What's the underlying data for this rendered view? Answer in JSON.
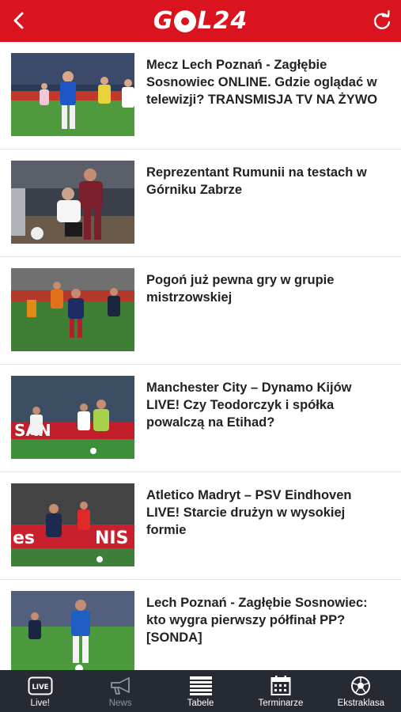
{
  "header": {
    "logo_text_left": "G",
    "logo_text_right": "L24",
    "back_icon": "chevron-left-icon",
    "refresh_icon": "refresh-icon",
    "bar_color": "#d9141f"
  },
  "articles": [
    {
      "title": "Mecz Lech Poznań - Zagłębie Sosnowiec ONLINE. Gdzie oglądać w telewizji? TRANSMISJA TV NA ŻYWO"
    },
    {
      "title": "Reprezentant Rumunii na testach w Górniku Zabrze"
    },
    {
      "title": "Pogoń już pewna gry w grupie mistrzowskiej"
    },
    {
      "title": "Manchester City – Dynamo Kijów LIVE! Czy Teodorczyk i spółka powalczą na Etihad?"
    },
    {
      "title": "Atletico Madryt – PSV Eindhoven LIVE! Starcie drużyn w wysokiej formie"
    },
    {
      "title": "Lech Poznań - Zagłębie Sosnowiec: kto wygra pierwszy półfinał PP? [SONDA]"
    }
  ],
  "tabs": [
    {
      "label": "Live!",
      "icon": "live-icon",
      "icon_text": "LIVE"
    },
    {
      "label": "News",
      "icon": "megaphone-icon"
    },
    {
      "label": "Tabele",
      "icon": "table-icon"
    },
    {
      "label": "Terminarze",
      "icon": "calendar-icon"
    },
    {
      "label": "Ekstraklasa",
      "icon": "football-icon"
    }
  ],
  "tabbar_color": "#262a33"
}
